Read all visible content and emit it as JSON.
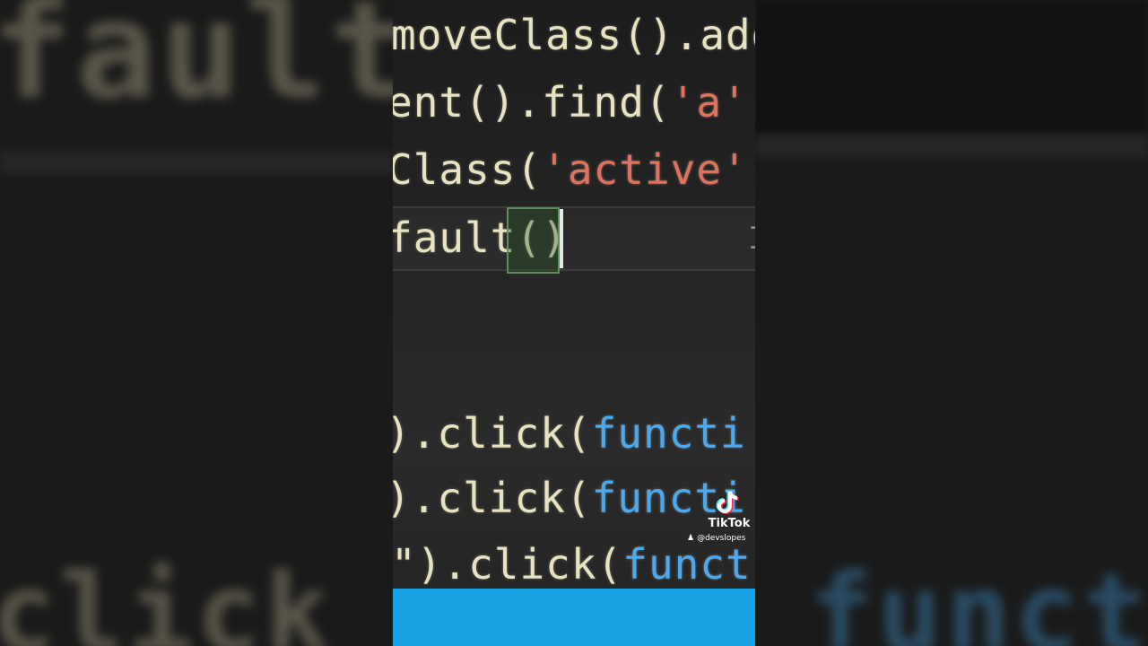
{
  "code": {
    "lines": [
      "moveClass().add",
      "ent().find(",
      "'a'",
      "Class(",
      "'active'",
      "fault",
      "()",
      ").click(",
      "functi",
      "\").click(",
      "funct"
    ]
  },
  "background": {
    "left_text": "fault",
    "right_text": "",
    "bottom_text": "click"
  },
  "overlay": {
    "brand": "TikTok",
    "username": "@devslopes",
    "logo_icon": "tiktok-logo-icon",
    "user_icon": "person-icon"
  },
  "colors": {
    "code_text": "#e6e2c2",
    "string": "#e0715f",
    "keyword": "#4aa9f0",
    "bracket_highlight": "#5f8d5f",
    "footer_bar": "#19a3e6"
  }
}
